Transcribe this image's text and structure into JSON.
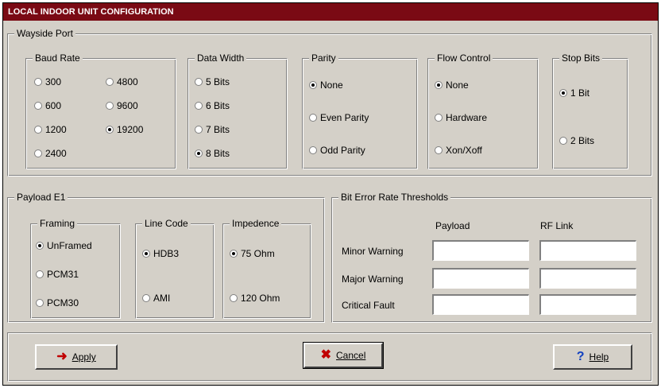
{
  "window": {
    "title": "LOCAL INDOOR UNIT CONFIGURATION",
    "title_color": "#7a0a14"
  },
  "wayside": {
    "title": "Wayside Port",
    "baud_rate": {
      "title": "Baud Rate",
      "options": [
        "300",
        "4800",
        "600",
        "9600",
        "1200",
        "19200",
        "2400"
      ],
      "selected": "19200"
    },
    "data_width": {
      "title": "Data Width",
      "options": [
        "5 Bits",
        "6 Bits",
        "7 Bits",
        "8 Bits"
      ],
      "selected": "8 Bits"
    },
    "parity": {
      "title": "Parity",
      "options": [
        "None",
        "Even Parity",
        "Odd Parity"
      ],
      "selected": "None"
    },
    "flow_control": {
      "title": "Flow Control",
      "options": [
        "None",
        "Hardware",
        "Xon/Xoff"
      ],
      "selected": "None"
    },
    "stop_bits": {
      "title": "Stop Bits",
      "options": [
        "1 Bit",
        "2 Bits"
      ],
      "selected": "1 Bit"
    }
  },
  "payload": {
    "title": "Payload E1",
    "framing": {
      "title": "Framing",
      "options": [
        "UnFramed",
        "PCM31",
        "PCM30"
      ],
      "selected": "UnFramed"
    },
    "line_code": {
      "title": "Line Code",
      "options": [
        "HDB3",
        "AMI"
      ],
      "selected": "HDB3"
    },
    "impedance": {
      "title": "Impedence",
      "options": [
        "75 Ohm",
        "120 Ohm"
      ],
      "selected": "75 Ohm"
    }
  },
  "ber": {
    "title": "Bit Error Rate Thresholds",
    "col_payload": "Payload",
    "col_rflink": "RF Link",
    "rows": [
      {
        "label": "Minor Warning",
        "payload": "",
        "rflink": ""
      },
      {
        "label": "Major Warning",
        "payload": "",
        "rflink": ""
      },
      {
        "label": "Critical Fault",
        "payload": "",
        "rflink": ""
      }
    ]
  },
  "buttons": {
    "apply": "Apply",
    "cancel": "Cancel",
    "help": "Help",
    "apply_icon": "apply-arrow-icon",
    "cancel_icon": "x-icon",
    "help_icon": "question-icon"
  }
}
